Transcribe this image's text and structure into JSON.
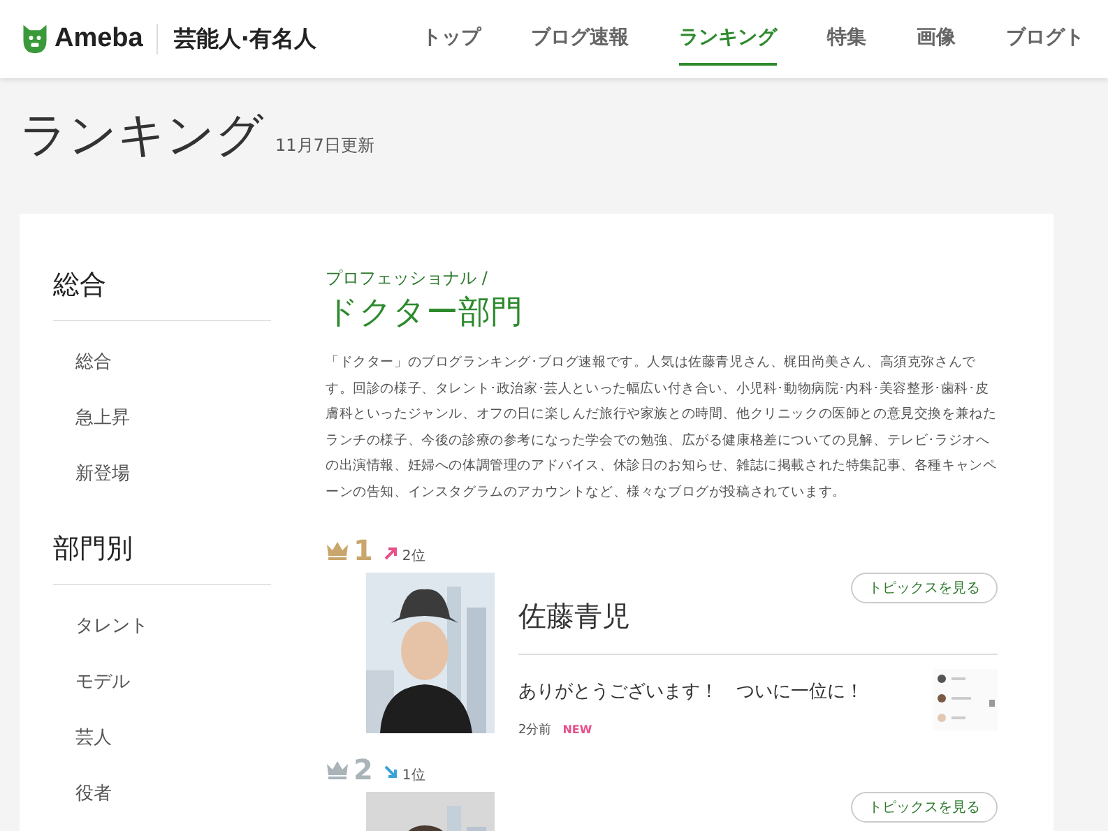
{
  "header": {
    "logo": "Ameba",
    "section": "芸能人·有名人",
    "nav": [
      {
        "label": "トップ",
        "selected": false
      },
      {
        "label": "ブログ速報",
        "selected": false
      },
      {
        "label": "ランキング",
        "selected": true
      },
      {
        "label": "特集",
        "selected": false
      },
      {
        "label": "画像",
        "selected": false
      },
      {
        "label": "ブログト",
        "selected": false
      }
    ]
  },
  "page": {
    "title": "ランキング",
    "updated": "11月7日更新"
  },
  "sidebar": [
    {
      "heading": "総合",
      "items": [
        "総合",
        "急上昇",
        "新登場"
      ]
    },
    {
      "heading": "部門別",
      "items": [
        "タレント",
        "モデル",
        "芸人",
        "役者"
      ]
    }
  ],
  "category": {
    "breadcrumb": "プロフェッショナル /",
    "title": "ドクター部門",
    "description": "「ドクター」のブログランキング･ブログ速報です。人気は佐藤青児さん、梶田尚美さん、高須克弥さんです。回診の様子、タレント･政治家･芸人といった幅広い付き合い、小児科･動物病院･内科･美容整形･歯科･皮膚科といったジャンル、オフの日に楽しんだ旅行や家族との時間、他クリニックの医師との意見交換を兼ねたランチの様子、今後の診療の参考になった学会での勉強、広がる健康格差についての見解、テレビ･ラジオへの出演情報、妊婦への体調管理のアドバイス、休診日のお知らせ、雑誌に掲載された特集記事、各種キャンペーンの告知、インスタグラムのアカウントなど、様々なブログが投稿されています。"
  },
  "ranking": [
    {
      "rank": "1",
      "color": "#c9a66b",
      "kind": "up",
      "previous": "2位",
      "name": "佐藤青児",
      "button": "トピックスを見る",
      "post": {
        "title": "ありがとうございます！　ついに一位に！",
        "time": "2分前",
        "badge": "NEW"
      }
    },
    {
      "rank": "2",
      "color": "#a9b3b8",
      "kind": "down",
      "previous": "1位",
      "button": "トピックスを見る"
    }
  ]
}
